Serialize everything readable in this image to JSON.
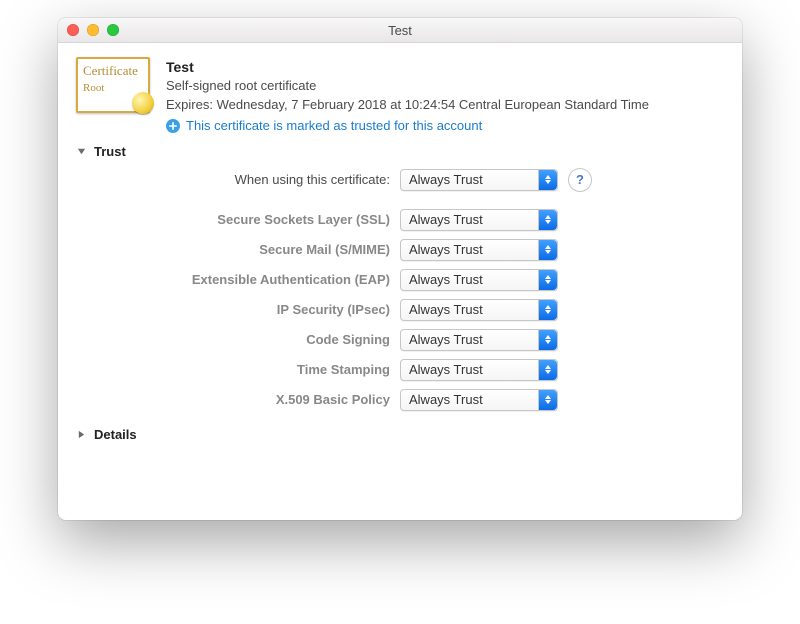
{
  "window": {
    "title": "Test"
  },
  "cert": {
    "name": "Test",
    "description": "Self-signed root certificate",
    "expires": "Expires: Wednesday, 7 February 2018 at 10:24:54 Central European Standard Time",
    "trust_status": "This certificate is marked as trusted for this account",
    "thumb_label": "Certificate",
    "thumb_sub": "Root"
  },
  "sections": {
    "trust_label": "Trust",
    "details_label": "Details"
  },
  "help": {
    "glyph": "?"
  },
  "trust": {
    "when_using_label": "When using this certificate:",
    "when_using_value": "Always Trust",
    "rows": [
      {
        "label": "Secure Sockets Layer (SSL)",
        "value": "Always Trust"
      },
      {
        "label": "Secure Mail (S/MIME)",
        "value": "Always Trust"
      },
      {
        "label": "Extensible Authentication (EAP)",
        "value": "Always Trust"
      },
      {
        "label": "IP Security (IPsec)",
        "value": "Always Trust"
      },
      {
        "label": "Code Signing",
        "value": "Always Trust"
      },
      {
        "label": "Time Stamping",
        "value": "Always Trust"
      },
      {
        "label": "X.509 Basic Policy",
        "value": "Always Trust"
      }
    ]
  }
}
